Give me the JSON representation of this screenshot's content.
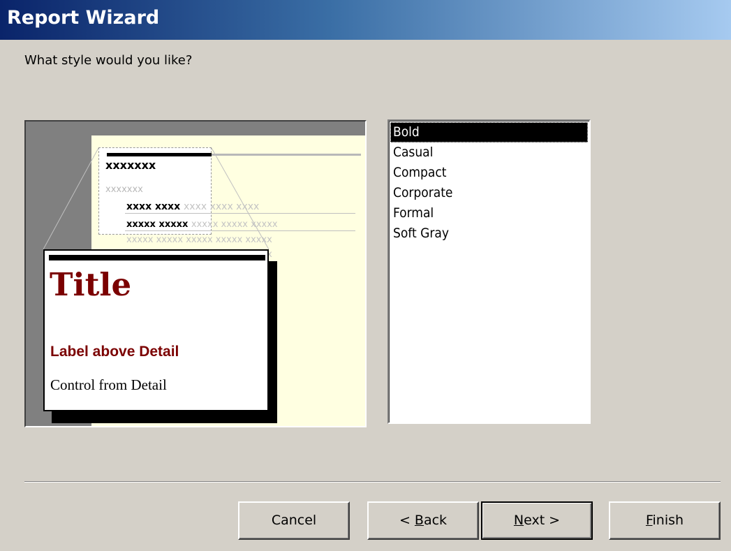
{
  "window": {
    "title": "Report Wizard"
  },
  "prompt": "What style would you like?",
  "preview": {
    "sample_title": "xxxxxxx",
    "sample_label": "xxxxxxx",
    "sample_row_1_bold": "xxxx xxxx",
    "sample_row_1_light": "xxxx xxxx xxxx",
    "sample_row_2_bold": "xxxxx xxxxx",
    "sample_row_2_light": "xxxxx xxxxx xxxxx",
    "sample_grey_row": "xxxxx xxxxx xxxxx xxxxx xxxxx",
    "callout_title": "Title",
    "callout_label": "Label above Detail",
    "callout_control": "Control from Detail"
  },
  "styles": {
    "items": [
      "Bold",
      "Casual",
      "Compact",
      "Corporate",
      "Formal",
      "Soft Gray"
    ],
    "selected": "Bold"
  },
  "buttons": {
    "cancel": "Cancel",
    "back_prefix": "< ",
    "back_key": "B",
    "back_rest": "ack",
    "next_key": "N",
    "next_rest": "ext >",
    "finish_key": "F",
    "finish_rest": "inish"
  },
  "colors": {
    "title_gradient_start": "#0a246a",
    "title_gradient_end": "#a6caf0",
    "accent_red": "#7b0000"
  }
}
